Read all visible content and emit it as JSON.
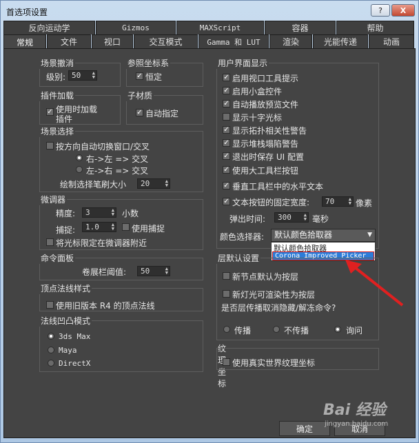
{
  "window": {
    "title": "首选项设置",
    "help": "?",
    "close": "X"
  },
  "tabs_row1": [
    "反向运动学",
    "Gizmos",
    "MAXScript",
    "容器",
    "帮助"
  ],
  "tabs_row2": [
    "常规",
    "文件",
    "视口",
    "交互模式",
    "Gamma 和 LUT",
    "渲染",
    "光能传递",
    "动画"
  ],
  "scene_undo": {
    "title": "场景撤消",
    "level_label": "级别:",
    "level_value": "50"
  },
  "ref_coord": {
    "title": "参照坐标系",
    "constant": "恒定"
  },
  "plugin_load": {
    "title": "插件加载",
    "load_on_demand": "使用时加载",
    "load_on_demand2": "插件"
  },
  "sub_material": {
    "title": "子材质",
    "auto_assign": "自动指定"
  },
  "scene_select": {
    "title": "场景选择",
    "auto_window": "按方向自动切换窗口/交叉",
    "rtl": "右->左 => 交叉",
    "ltr": "左->右 => 交叉",
    "brush_label": "绘制选择笔刷大小",
    "brush_value": "20"
  },
  "spinners": {
    "title": "微调器",
    "precision_label": "精度:",
    "precision_value": "3",
    "decimal": "小数",
    "snap_label": "捕捉:",
    "snap_value": "1.0",
    "use_snap": "使用捕捉",
    "wrap": "将光标限定在微调器附近"
  },
  "cmd_panel": {
    "title": "命令面板",
    "rollup_label": "卷展栏阈值:",
    "rollup_value": "50"
  },
  "vertex_normal": {
    "title": "顶点法线样式",
    "legacy": "使用旧版本 R4 的顶点法线"
  },
  "bump": {
    "title": "法线凹凸模式",
    "opt1": "3ds Max",
    "opt2": "Maya",
    "opt3": "DirectX"
  },
  "ui_display": {
    "title": "用户界面显示",
    "items": [
      "启用视口工具提示",
      "启用小盒控件",
      "自动播放预览文件",
      "显示十字光标",
      "显示拓扑相关性警告",
      "显示堆栈塌陷警告",
      "退出时保存 UI 配置",
      "使用大工具栏按钮",
      "垂直工具栏中的水平文本",
      "文本按钮的固定宽度:"
    ],
    "fixed_width_value": "70",
    "fixed_width_unit": "像素",
    "flyout_label": "弹出时间:",
    "flyout_value": "300",
    "flyout_unit": "毫秒",
    "color_picker_label": "颜色选择器:",
    "color_picker_value": "默认颜色拾取器",
    "options": [
      "默认颜色拾取器",
      "Corona Improved Picker"
    ]
  },
  "layer": {
    "title": "层默认设置",
    "new_nodes": "新节点默认为按层",
    "new_lights": "新灯光可渲染性为按层",
    "propagate": "是否层传播取消隐藏/解冻命令?",
    "r1": "传播",
    "r2": "不传播",
    "r3": "询问"
  },
  "tex": {
    "title": "纹理坐标",
    "real_world": "使用真实世界纹理坐标"
  },
  "buttons": {
    "ok": "确定",
    "cancel": "取消"
  },
  "watermark": {
    "text": "Bai 经验",
    "url": "jingyan.baidu.com"
  }
}
